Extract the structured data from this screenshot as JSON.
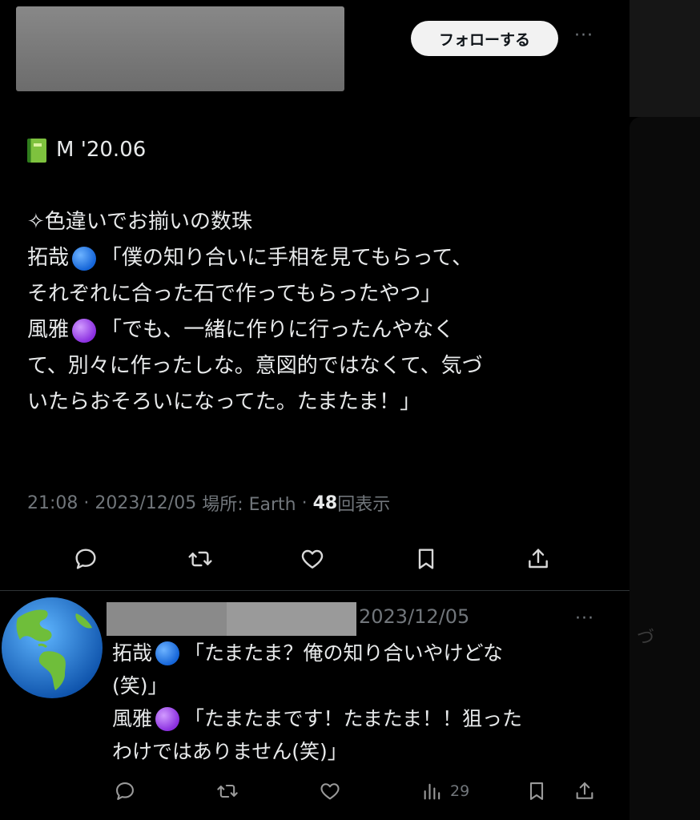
{
  "header": {
    "follow_label": "フォローする",
    "more_label": "···"
  },
  "tweet": {
    "lines": [
      {
        "text": "M '20.06"
      },
      {
        "text": ""
      },
      {
        "text": "✧色違いでお揃いの数珠"
      },
      {
        "speaker": "拓哉",
        "text": "「僕の知り合いに手相を見てもらって、"
      },
      {
        "text": "それぞれに合った石で作ってもらったやつ」"
      },
      {
        "speaker": "風雅",
        "text": "「でも、一緒に作りに行ったんやなく"
      },
      {
        "text": "て、別々に作ったしな。意図的ではなくて、気づ"
      },
      {
        "text": "いたらおそろいになってた。たまたま！」"
      }
    ],
    "meta": {
      "time": "21:08",
      "sep": " · ",
      "date": "2023/12/05",
      "location": "場所: Earth",
      "views": "48",
      "views_label": "回表示"
    }
  },
  "reply": {
    "date": "2023/12/05",
    "more_label": "···",
    "lines": [
      {
        "speaker": "拓哉",
        "text": "「たまたま？俺の知り合いやけどな"
      },
      {
        "text": "(笑)」"
      },
      {
        "speaker": "風雅",
        "text": "「たまたまです！たまたま！！狙った"
      },
      {
        "text": "わけではありません(笑)」"
      }
    ],
    "views": "29"
  },
  "side": {
    "glyph": "づ"
  },
  "icons": [
    "more-icon",
    "book-icon",
    "blue-circle-icon",
    "purple-circle-icon",
    "reply-icon",
    "retweet-icon",
    "like-icon",
    "bookmark-icon",
    "share-icon",
    "views-icon",
    "globe-icon"
  ],
  "colors": {
    "background": "#000000",
    "text": "#e7e9ea",
    "muted": "#71767b",
    "blue_dot": "#1e6fe6",
    "purple_dot": "#9b3ff0",
    "follow_bg": "#f2f2f2"
  }
}
